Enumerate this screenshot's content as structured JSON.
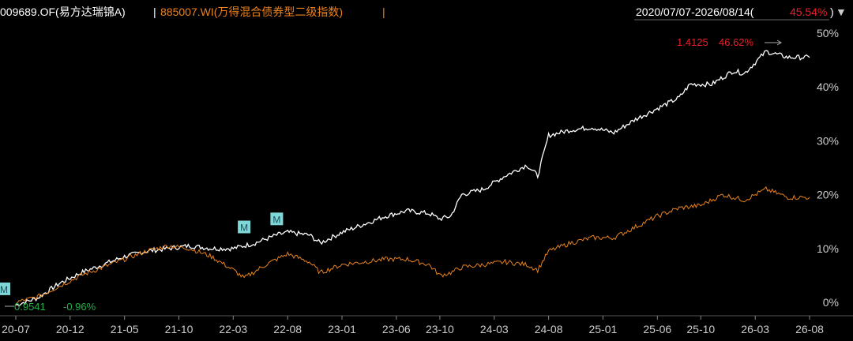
{
  "header": {
    "fund_label": "009689.OF(易方达瑞锦A)",
    "separator": "|",
    "index_label": "885007.WI(万得混合债券型二级指数)",
    "range_label": "2020/07/07-2026/08/14(",
    "range_return": "45.54%",
    "range_close": ")",
    "dropdown_glyph": "▼"
  },
  "colors": {
    "background": "#000000",
    "fund_line": "#ffffff",
    "index_line": "#e8821e",
    "text": "#ffffff",
    "index_text": "#e8821e",
    "up": "#e8202a",
    "down": "#22b04a",
    "marker_bg": "#7fd8d8",
    "axis": "#cccccc",
    "grid": "#333333"
  },
  "annotations": {
    "max_value": "1.4125",
    "max_pct": "46.62%",
    "min_value": "0.9541",
    "min_pct": "-0.96%",
    "marker_label": "M"
  },
  "chart_data": {
    "type": "line",
    "x_ticks": [
      "20-07",
      "20-12",
      "21-05",
      "21-10",
      "22-03",
      "22-08",
      "23-01",
      "23-06",
      "23-10",
      "24-03",
      "24-08",
      "25-01",
      "25-06",
      "25-10",
      "26-03",
      "26-08"
    ],
    "y_ticks": [
      "0%",
      "10%",
      "20%",
      "30%",
      "40%",
      "50%"
    ],
    "ylim": [
      -2,
      50
    ],
    "grid": false,
    "series": [
      {
        "name": "009689.OF(易方达瑞锦A)",
        "color": "#ffffff",
        "points": [
          [
            "2020-07",
            -0.5
          ],
          [
            "2020-09",
            0.8
          ],
          [
            "2020-11",
            3.5
          ],
          [
            "2021-01",
            5.5
          ],
          [
            "2021-03",
            7.0
          ],
          [
            "2021-05",
            8.5
          ],
          [
            "2021-07",
            9.5
          ],
          [
            "2021-09",
            10.0
          ],
          [
            "2021-11",
            10.5
          ],
          [
            "2022-01",
            10.0
          ],
          [
            "2022-03",
            10.0
          ],
          [
            "2022-05",
            11.0
          ],
          [
            "2022-07",
            12.5
          ],
          [
            "2022-08",
            13.0
          ],
          [
            "2022-10",
            12.5
          ],
          [
            "2022-11",
            11.0
          ],
          [
            "2023-01",
            13.0
          ],
          [
            "2023-03",
            14.5
          ],
          [
            "2023-05",
            16.0
          ],
          [
            "2023-07",
            17.0
          ],
          [
            "2023-09",
            16.5
          ],
          [
            "2023-10",
            15.5
          ],
          [
            "2023-11",
            16.0
          ],
          [
            "2023-12",
            20.0
          ],
          [
            "2024-02",
            21.0
          ],
          [
            "2024-04",
            23.5
          ],
          [
            "2024-06",
            25.5
          ],
          [
            "2024-07",
            23.5
          ],
          [
            "2024-08",
            31.0
          ],
          [
            "2024-10",
            32.0
          ],
          [
            "2024-12",
            32.5
          ],
          [
            "2025-02",
            31.5
          ],
          [
            "2025-04",
            34.0
          ],
          [
            "2025-06",
            36.0
          ],
          [
            "2025-08",
            38.0
          ],
          [
            "2025-09",
            40.5
          ],
          [
            "2025-11",
            40.5
          ],
          [
            "2026-01",
            43.0
          ],
          [
            "2026-02",
            42.5
          ],
          [
            "2026-04",
            46.6
          ],
          [
            "2026-06",
            45.5
          ],
          [
            "2026-08",
            45.5
          ]
        ]
      },
      {
        "name": "885007.WI(万得混合债券型二级指数)",
        "color": "#e8821e",
        "points": [
          [
            "2020-07",
            0.0
          ],
          [
            "2020-09",
            1.0
          ],
          [
            "2020-11",
            3.0
          ],
          [
            "2021-01",
            5.0
          ],
          [
            "2021-03",
            6.5
          ],
          [
            "2021-05",
            8.0
          ],
          [
            "2021-07",
            9.5
          ],
          [
            "2021-09",
            10.5
          ],
          [
            "2021-11",
            10.0
          ],
          [
            "2022-01",
            8.5
          ],
          [
            "2022-03",
            6.0
          ],
          [
            "2022-04",
            4.5
          ],
          [
            "2022-06",
            7.0
          ],
          [
            "2022-08",
            9.0
          ],
          [
            "2022-10",
            7.5
          ],
          [
            "2022-11",
            5.5
          ],
          [
            "2023-01",
            7.0
          ],
          [
            "2023-03",
            7.5
          ],
          [
            "2023-05",
            8.0
          ],
          [
            "2023-07",
            8.0
          ],
          [
            "2023-09",
            7.0
          ],
          [
            "2023-10",
            5.0
          ],
          [
            "2023-11",
            5.5
          ],
          [
            "2023-12",
            6.5
          ],
          [
            "2024-02",
            7.0
          ],
          [
            "2024-04",
            7.5
          ],
          [
            "2024-06",
            7.0
          ],
          [
            "2024-07",
            6.0
          ],
          [
            "2024-08",
            9.5
          ],
          [
            "2024-10",
            11.0
          ],
          [
            "2024-12",
            12.0
          ],
          [
            "2025-02",
            12.0
          ],
          [
            "2025-04",
            14.0
          ],
          [
            "2025-06",
            16.0
          ],
          [
            "2025-08",
            17.5
          ],
          [
            "2025-10",
            18.0
          ],
          [
            "2025-12",
            20.0
          ],
          [
            "2026-02",
            19.0
          ],
          [
            "2026-04",
            21.0
          ],
          [
            "2026-06",
            19.5
          ],
          [
            "2026-08",
            19.5
          ]
        ]
      }
    ],
    "markers": [
      {
        "date": "2020-07",
        "value": 2.5
      },
      {
        "date": "2022-04",
        "value": 14.0
      },
      {
        "date": "2022-07",
        "value": 15.5
      }
    ]
  }
}
